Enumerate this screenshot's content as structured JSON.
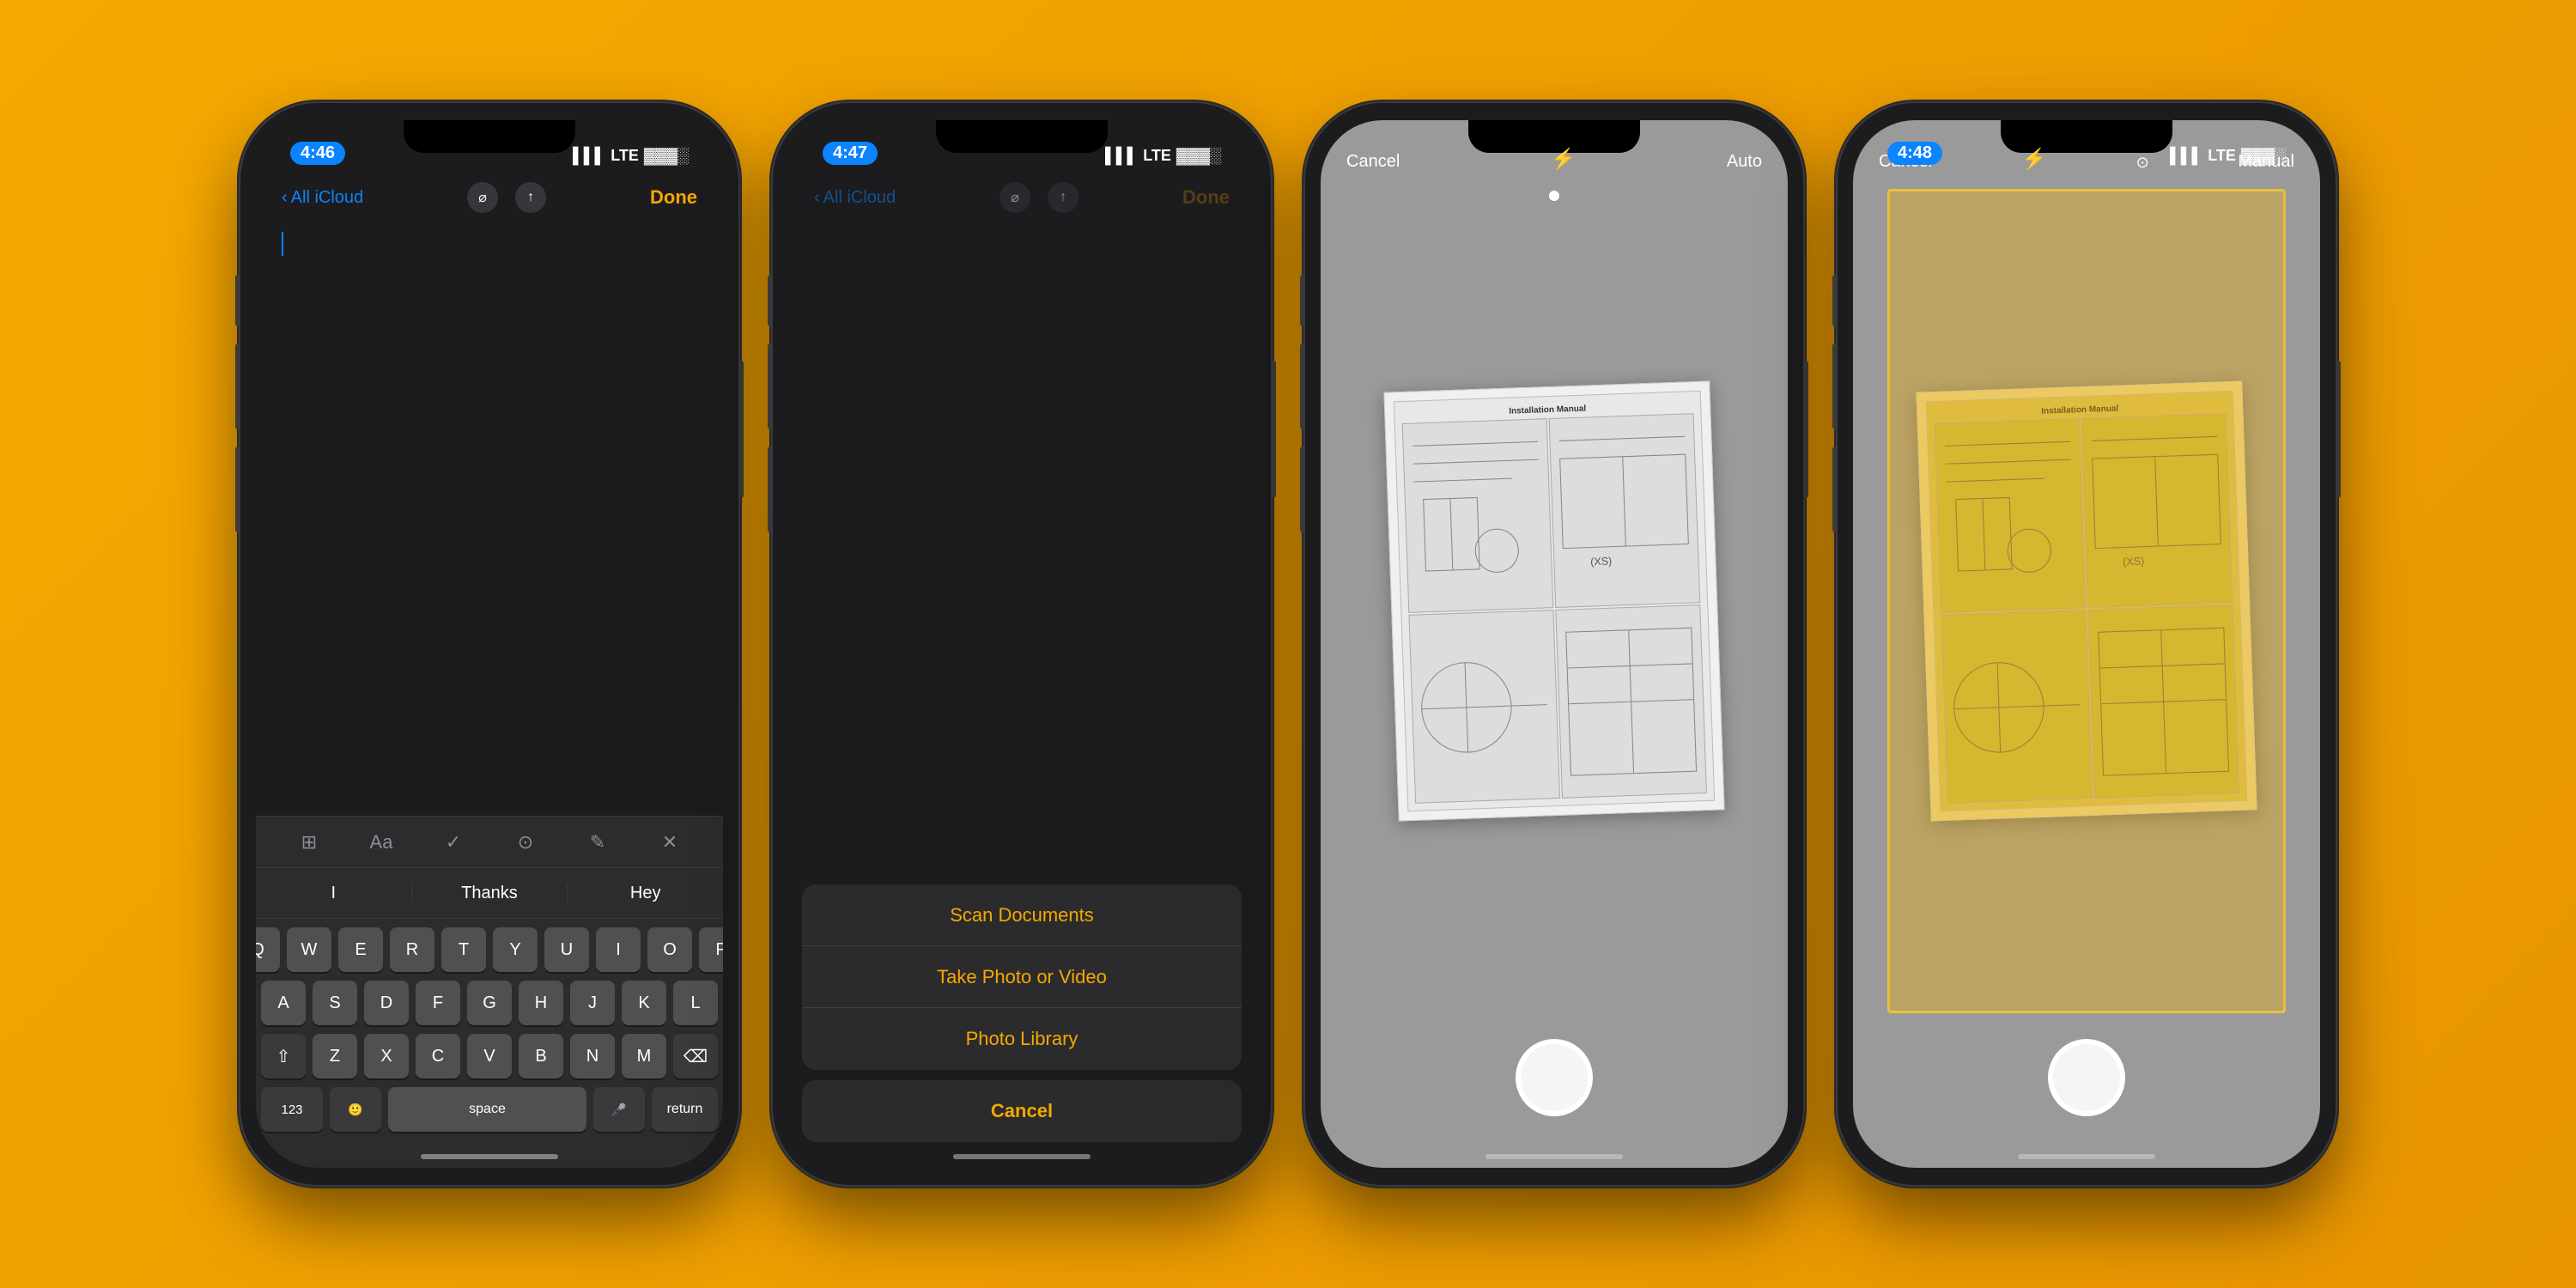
{
  "background_color": "#F5A800",
  "phones": [
    {
      "id": "phone1",
      "time": "4:46",
      "nav": {
        "back_label": "All iCloud",
        "done_label": "Done"
      },
      "content_type": "notes_keyboard",
      "toolbar_icons": [
        "⊞",
        "Aa",
        "✓",
        "⊙",
        "✈",
        "✕"
      ],
      "predictive": [
        "I",
        "Thanks",
        "Hey"
      ],
      "keyboard_rows": [
        [
          "Q",
          "W",
          "E",
          "R",
          "T",
          "Y",
          "U",
          "I",
          "O",
          "P"
        ],
        [
          "A",
          "S",
          "D",
          "F",
          "G",
          "H",
          "J",
          "K",
          "L"
        ],
        [
          "⇧",
          "Z",
          "X",
          "C",
          "V",
          "B",
          "N",
          "M",
          "⌫"
        ],
        [
          "123",
          "space",
          "return"
        ]
      ]
    },
    {
      "id": "phone2",
      "time": "4:47",
      "nav": {
        "back_label": "All iCloud",
        "done_label": "Done"
      },
      "content_type": "action_sheet",
      "action_items": [
        "Scan Documents",
        "Take Photo or Video",
        "Photo Library"
      ],
      "cancel_label": "Cancel"
    },
    {
      "id": "phone3",
      "time": "",
      "content_type": "camera_auto",
      "cam_controls": {
        "cancel": "Cancel",
        "mode": "Auto"
      }
    },
    {
      "id": "phone4",
      "time": "4:48",
      "content_type": "camera_manual",
      "cam_controls": {
        "cancel": "Cancel",
        "mode": "Manual"
      }
    }
  ]
}
